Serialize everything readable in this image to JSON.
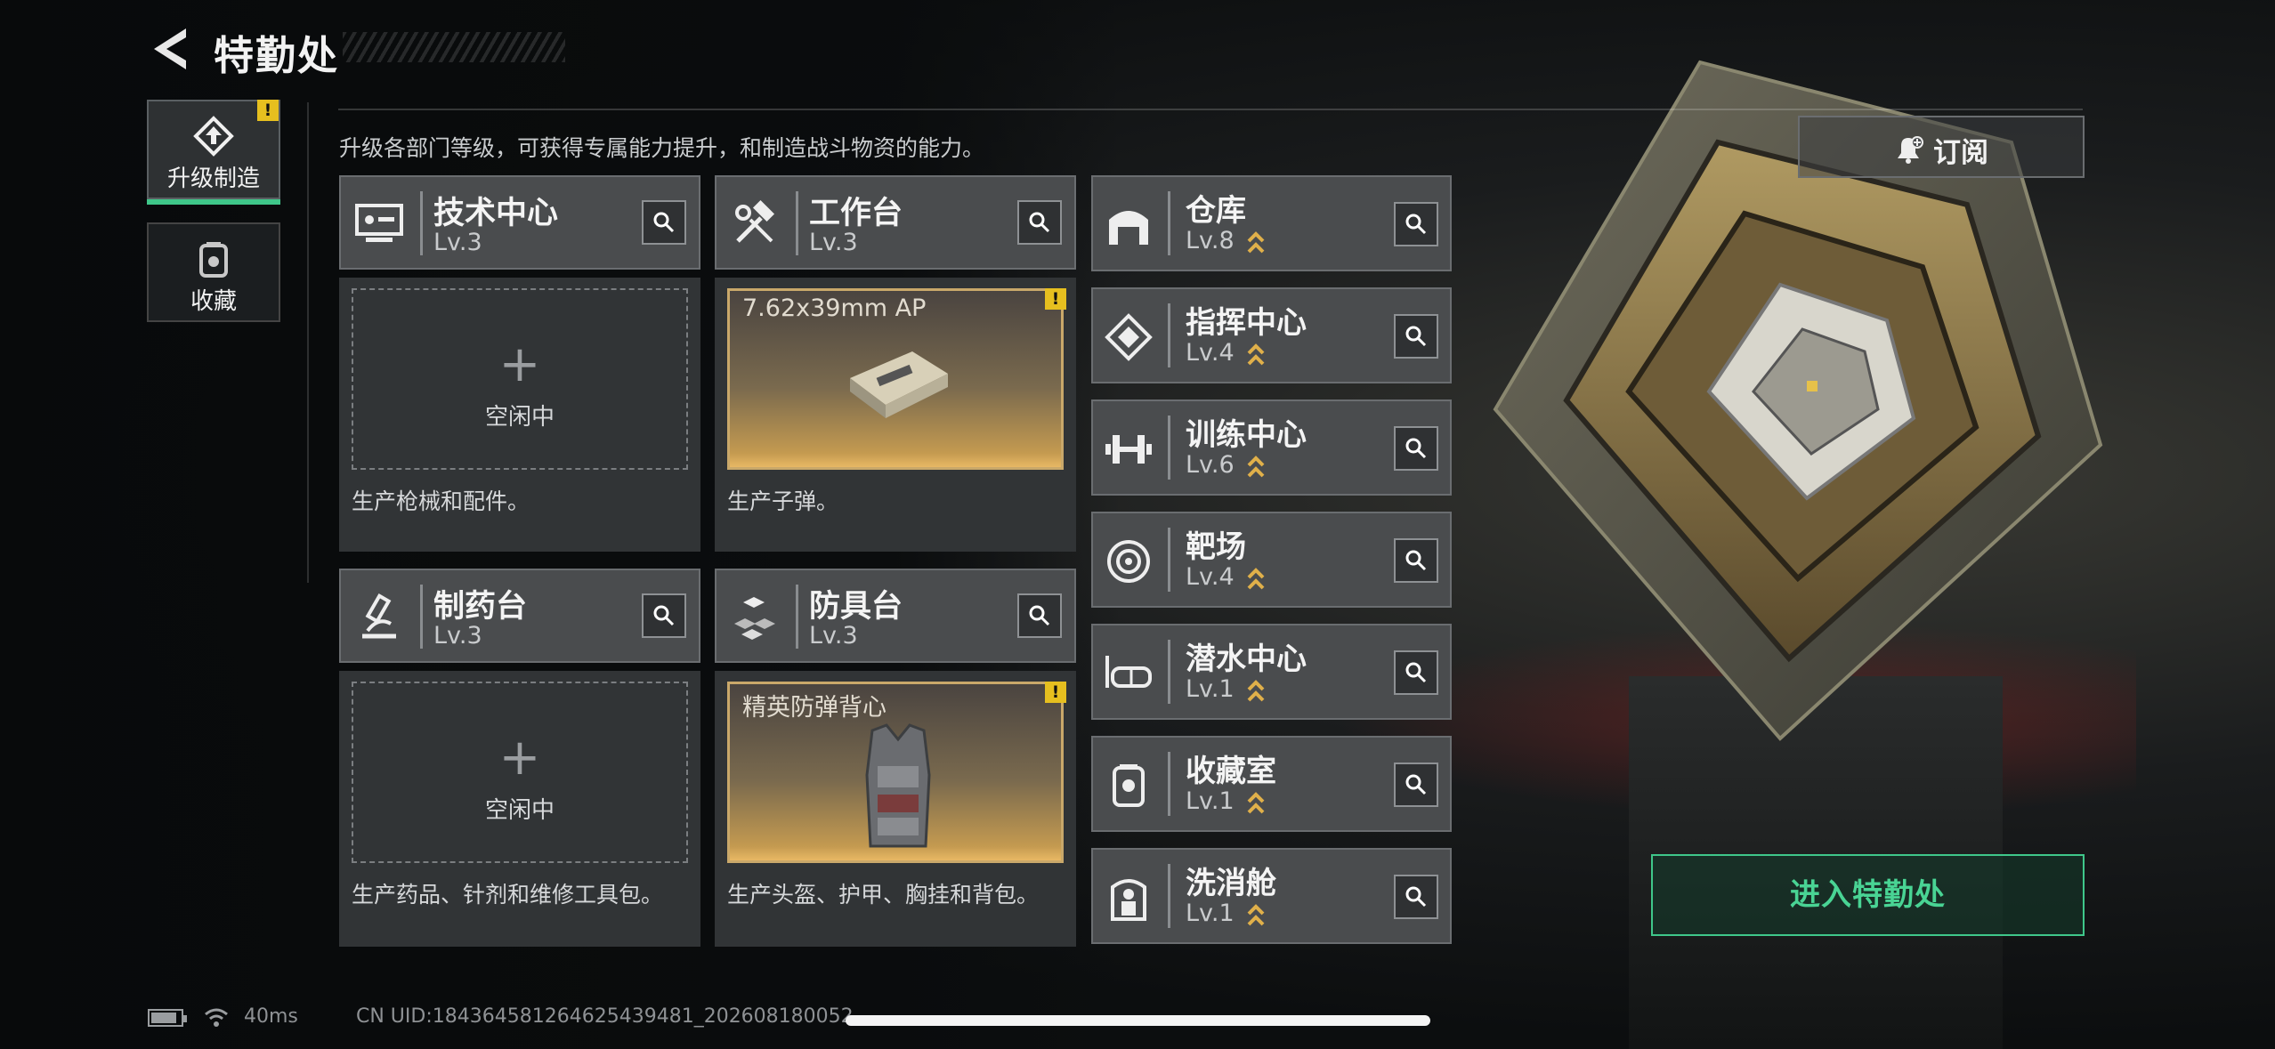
{
  "header": {
    "title": "特勤处"
  },
  "nav": {
    "items": [
      {
        "label": "升级制造",
        "active": true,
        "warning": true,
        "icon": "upgrade-manufacture-icon"
      },
      {
        "label": "收藏",
        "active": false,
        "warning": false,
        "icon": "collection-icon"
      }
    ]
  },
  "subtitle": "升级各部门等级，可获得专属能力提升，和制造战斗物资的能力。",
  "workshops": [
    {
      "name": "技术中心",
      "level": "Lv.3",
      "slot_state": "空闲中",
      "slot_plus": "+",
      "description": "生产枪械和配件。",
      "icon": "tech-center-icon"
    },
    {
      "name": "工作台",
      "level": "Lv.3",
      "product": "7.62x39mm AP",
      "warning": true,
      "description": "生产子弹。",
      "icon": "workbench-icon"
    },
    {
      "name": "制药台",
      "level": "Lv.3",
      "slot_state": "空闲中",
      "slot_plus": "+",
      "description": "生产药品、针剂和维修工具包。",
      "icon": "pharmacy-icon"
    },
    {
      "name": "防具台",
      "level": "Lv.3",
      "product": "精英防弹背心",
      "warning": true,
      "description": "生产头盔、护甲、胸挂和背包。",
      "icon": "armor-bench-icon"
    }
  ],
  "departments": [
    {
      "name": "仓库",
      "level": "Lv.8",
      "upgradable": true,
      "icon": "warehouse-icon"
    },
    {
      "name": "指挥中心",
      "level": "Lv.4",
      "upgradable": true,
      "icon": "command-center-icon"
    },
    {
      "name": "训练中心",
      "level": "Lv.6",
      "upgradable": true,
      "icon": "training-center-icon"
    },
    {
      "name": "靶场",
      "level": "Lv.4",
      "upgradable": true,
      "icon": "shooting-range-icon"
    },
    {
      "name": "潜水中心",
      "level": "Lv.1",
      "upgradable": true,
      "icon": "diving-center-icon"
    },
    {
      "name": "收藏室",
      "level": "Lv.1",
      "upgradable": true,
      "icon": "collection-room-icon"
    },
    {
      "name": "洗消舱",
      "level": "Lv.1",
      "upgradable": true,
      "icon": "decontamination-icon"
    }
  ],
  "actions": {
    "subscribe": "订阅",
    "enter": "进入特勤处"
  },
  "status": {
    "ping": "40ms",
    "uid": "CN UID:1843645812646254394​81_202608180052"
  },
  "colors": {
    "accent": "#3fc78a",
    "warning": "#e6bf1f",
    "product_gold": "#c49a50",
    "panel": "#4a4c4e"
  }
}
